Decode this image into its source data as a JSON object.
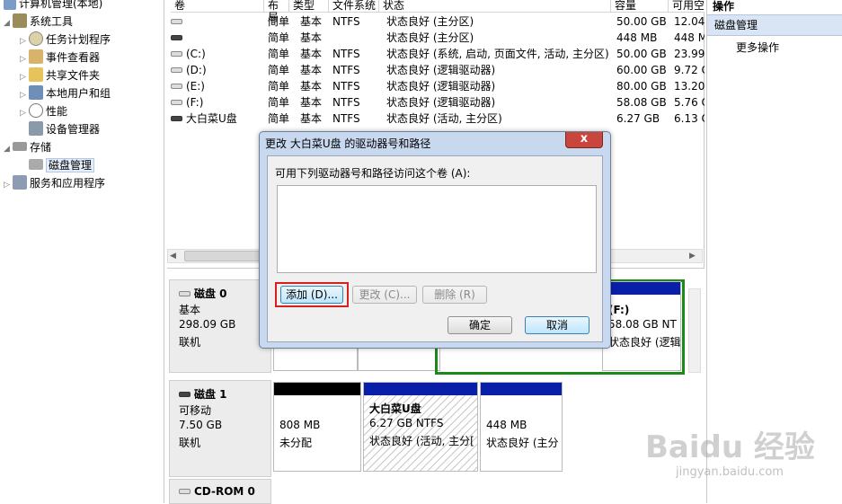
{
  "tree": {
    "root": "计算机管理(本地)",
    "system_tools": "系统工具",
    "task_scheduler": "任务计划程序",
    "event_viewer": "事件查看器",
    "shared_folders": "共享文件夹",
    "local_users": "本地用户和组",
    "performance": "性能",
    "device_manager": "设备管理器",
    "storage": "存储",
    "disk_management": "磁盘管理",
    "services_apps": "服务和应用程序"
  },
  "volumes": {
    "headers": {
      "vol": "卷",
      "layout": "布局",
      "type": "类型",
      "fs": "文件系统",
      "status": "状态",
      "capacity": "容量",
      "free": "可用空"
    },
    "rows": [
      {
        "name": "",
        "layout": "简单",
        "type": "基本",
        "fs": "NTFS",
        "status": "状态良好 (主分区)",
        "capacity": "50.00 GB",
        "free": "12.04"
      },
      {
        "name": "",
        "layout": "简单",
        "type": "基本",
        "fs": "",
        "status": "状态良好 (主分区)",
        "capacity": "448 MB",
        "free": "448 M"
      },
      {
        "name": "(C:)",
        "layout": "简单",
        "type": "基本",
        "fs": "NTFS",
        "status": "状态良好 (系统, 启动, 页面文件, 活动, 主分区)",
        "capacity": "50.00 GB",
        "free": "23.99"
      },
      {
        "name": "(D:)",
        "layout": "简单",
        "type": "基本",
        "fs": "NTFS",
        "status": "状态良好 (逻辑驱动器)",
        "capacity": "60.00 GB",
        "free": "9.72 C"
      },
      {
        "name": "(E:)",
        "layout": "简单",
        "type": "基本",
        "fs": "NTFS",
        "status": "状态良好 (逻辑驱动器)",
        "capacity": "80.00 GB",
        "free": "13.20"
      },
      {
        "name": "(F:)",
        "layout": "简单",
        "type": "基本",
        "fs": "NTFS",
        "status": "状态良好 (逻辑驱动器)",
        "capacity": "58.08 GB",
        "free": "5.76 C"
      },
      {
        "name": "大白菜U盘",
        "layout": "简单",
        "type": "基本",
        "fs": "NTFS",
        "status": "状态良好 (活动, 主分区)",
        "capacity": "6.27 GB",
        "free": "6.13 C"
      }
    ]
  },
  "disk0": {
    "name": "磁盘 0",
    "type": "基本",
    "size": "298.09 GB",
    "state": "联机",
    "partF": {
      "title": "(F:)",
      "line1": "58.08 GB NT",
      "line2": "状态良好 (逻辑"
    }
  },
  "disk1": {
    "name": "磁盘 1",
    "type": "可移动",
    "size": "7.50 GB",
    "state": "联机",
    "p1": {
      "line1": "808 MB",
      "line2": "未分配"
    },
    "p2": {
      "title": "大白菜U盘",
      "line1": "6.27 GB NTFS",
      "line2": "状态良好 (活动, 主分["
    },
    "p3": {
      "line1": "448 MB",
      "line2": "状态良好 (主分"
    }
  },
  "cdrom": {
    "name": "CD-ROM 0"
  },
  "ops": {
    "header": "操作",
    "section": "磁盘管理",
    "more": "更多操作"
  },
  "dialog": {
    "title": "更改 大白菜U盘 的驱动器号和路径",
    "close": "x",
    "prompt": "可用下列驱动器号和路径访问这个卷 (A):",
    "add": "添加 (D)...",
    "change": "更改 (C)...",
    "remove": "删除 (R)",
    "ok": "确定",
    "cancel": "取消"
  },
  "watermark": {
    "logo": "Baidu 经验",
    "url": "jingyan.baidu.com"
  },
  "colors": {
    "primary_bar": "#0a1fa8",
    "unallocated_bar": "#000000",
    "selection": "#1a8a1a",
    "highlight_box": "#d62020"
  }
}
